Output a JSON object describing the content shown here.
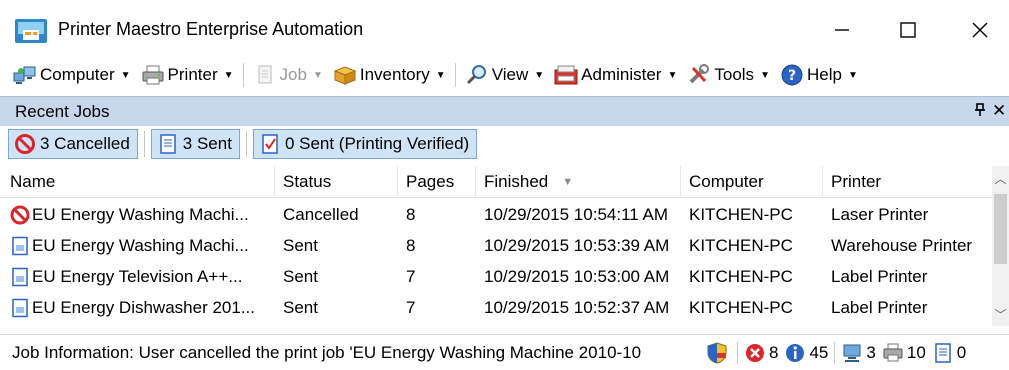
{
  "window": {
    "title": "Printer Maestro Enterprise Automation",
    "minimize_glyph": "—",
    "maximize_glyph": "☐",
    "close_glyph": "✕"
  },
  "toolbar": {
    "items": [
      {
        "label": "Computer",
        "icon": "computer-icon",
        "enabled": true
      },
      {
        "label": "Printer",
        "icon": "printer-icon",
        "enabled": true
      },
      {
        "label": "Job",
        "icon": "job-icon",
        "enabled": false
      },
      {
        "label": "Inventory",
        "icon": "inventory-icon",
        "enabled": true
      },
      {
        "label": "View",
        "icon": "magnifier-icon",
        "enabled": true
      },
      {
        "label": "Administer",
        "icon": "administer-icon",
        "enabled": true
      },
      {
        "label": "Tools",
        "icon": "tools-icon",
        "enabled": true
      },
      {
        "label": "Help",
        "icon": "help-icon",
        "enabled": true
      }
    ]
  },
  "pane": {
    "title": "Recent Jobs",
    "pin_glyph": "ᆛ",
    "close_glyph": "✕"
  },
  "filters": {
    "cancelled": "3 Cancelled",
    "sent": "3 Sent",
    "verified": "0 Sent (Printing Verified)"
  },
  "grid": {
    "columns": {
      "name": "Name",
      "status": "Status",
      "pages": "Pages",
      "finished": "Finished",
      "computer": "Computer",
      "printer": "Printer"
    },
    "rows": [
      {
        "icon": "cancelled-icon",
        "name": "EU Energy Washing Machi...",
        "status": "Cancelled",
        "pages": "8",
        "finished": "10/29/2015 10:54:11 AM",
        "computer": "KITCHEN-PC",
        "printer": "Laser Printer"
      },
      {
        "icon": "sent-document-icon",
        "name": "EU Energy Washing Machi...",
        "status": "Sent",
        "pages": "8",
        "finished": "10/29/2015 10:53:39 AM",
        "computer": "KITCHEN-PC",
        "printer": "Warehouse Printer"
      },
      {
        "icon": "sent-document-icon",
        "name": "EU Energy Television A++...",
        "status": "Sent",
        "pages": "7",
        "finished": "10/29/2015 10:53:00 AM",
        "computer": "KITCHEN-PC",
        "printer": "Label Printer"
      },
      {
        "icon": "sent-document-icon",
        "name": "EU Energy Dishwasher 201...",
        "status": "Sent",
        "pages": "7",
        "finished": "10/29/2015 10:52:37 AM",
        "computer": "KITCHEN-PC",
        "printer": "Label Printer"
      }
    ]
  },
  "statusbar": {
    "message": "Job Information: User cancelled the print job 'EU Energy Washing Machine 2010-10",
    "errors": "8",
    "info": "45",
    "computers": "3",
    "printers": "10",
    "documents": "0"
  },
  "colors": {
    "pane_header": "#c7d6ea",
    "filter_active": "#cfe3f7",
    "cancel_red": "#d9262c",
    "info_blue": "#2a64c4"
  }
}
